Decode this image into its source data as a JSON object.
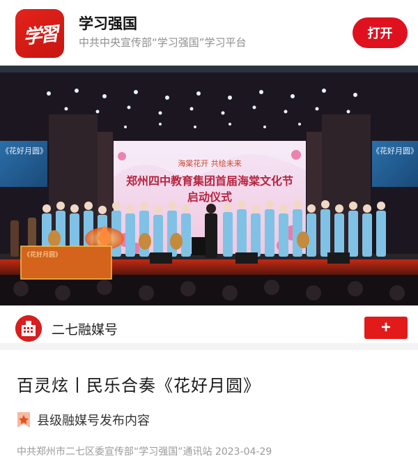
{
  "banner": {
    "logo_glyph": "学習",
    "app_name": "学习强国",
    "app_desc": "中共中央宣传部“学习强国”学习平台",
    "open_label": "打开",
    "brand_color": "#e0111f"
  },
  "media": {
    "stage_screen_line1": "海棠花开  共绘未来",
    "stage_screen_line2": "郑州四中教育集团首届海棠文化节",
    "stage_screen_line3": "启动仪式",
    "side_screen_left": "《花好月圆》",
    "side_screen_right": "《花好月圆》",
    "caption_title": "《花好月圆》"
  },
  "account": {
    "name": "二七融媒号",
    "follow_label": "+",
    "avatar_icon": "building-icon"
  },
  "article": {
    "title": "百灵炫丨民乐合奏《花好月圆》",
    "source_label": "县级融媒号发布内容",
    "source_icon": "star-badge-icon",
    "meta": "中共郑州市二七区委宣传部“学习强国”通讯站  2023-04-29"
  }
}
